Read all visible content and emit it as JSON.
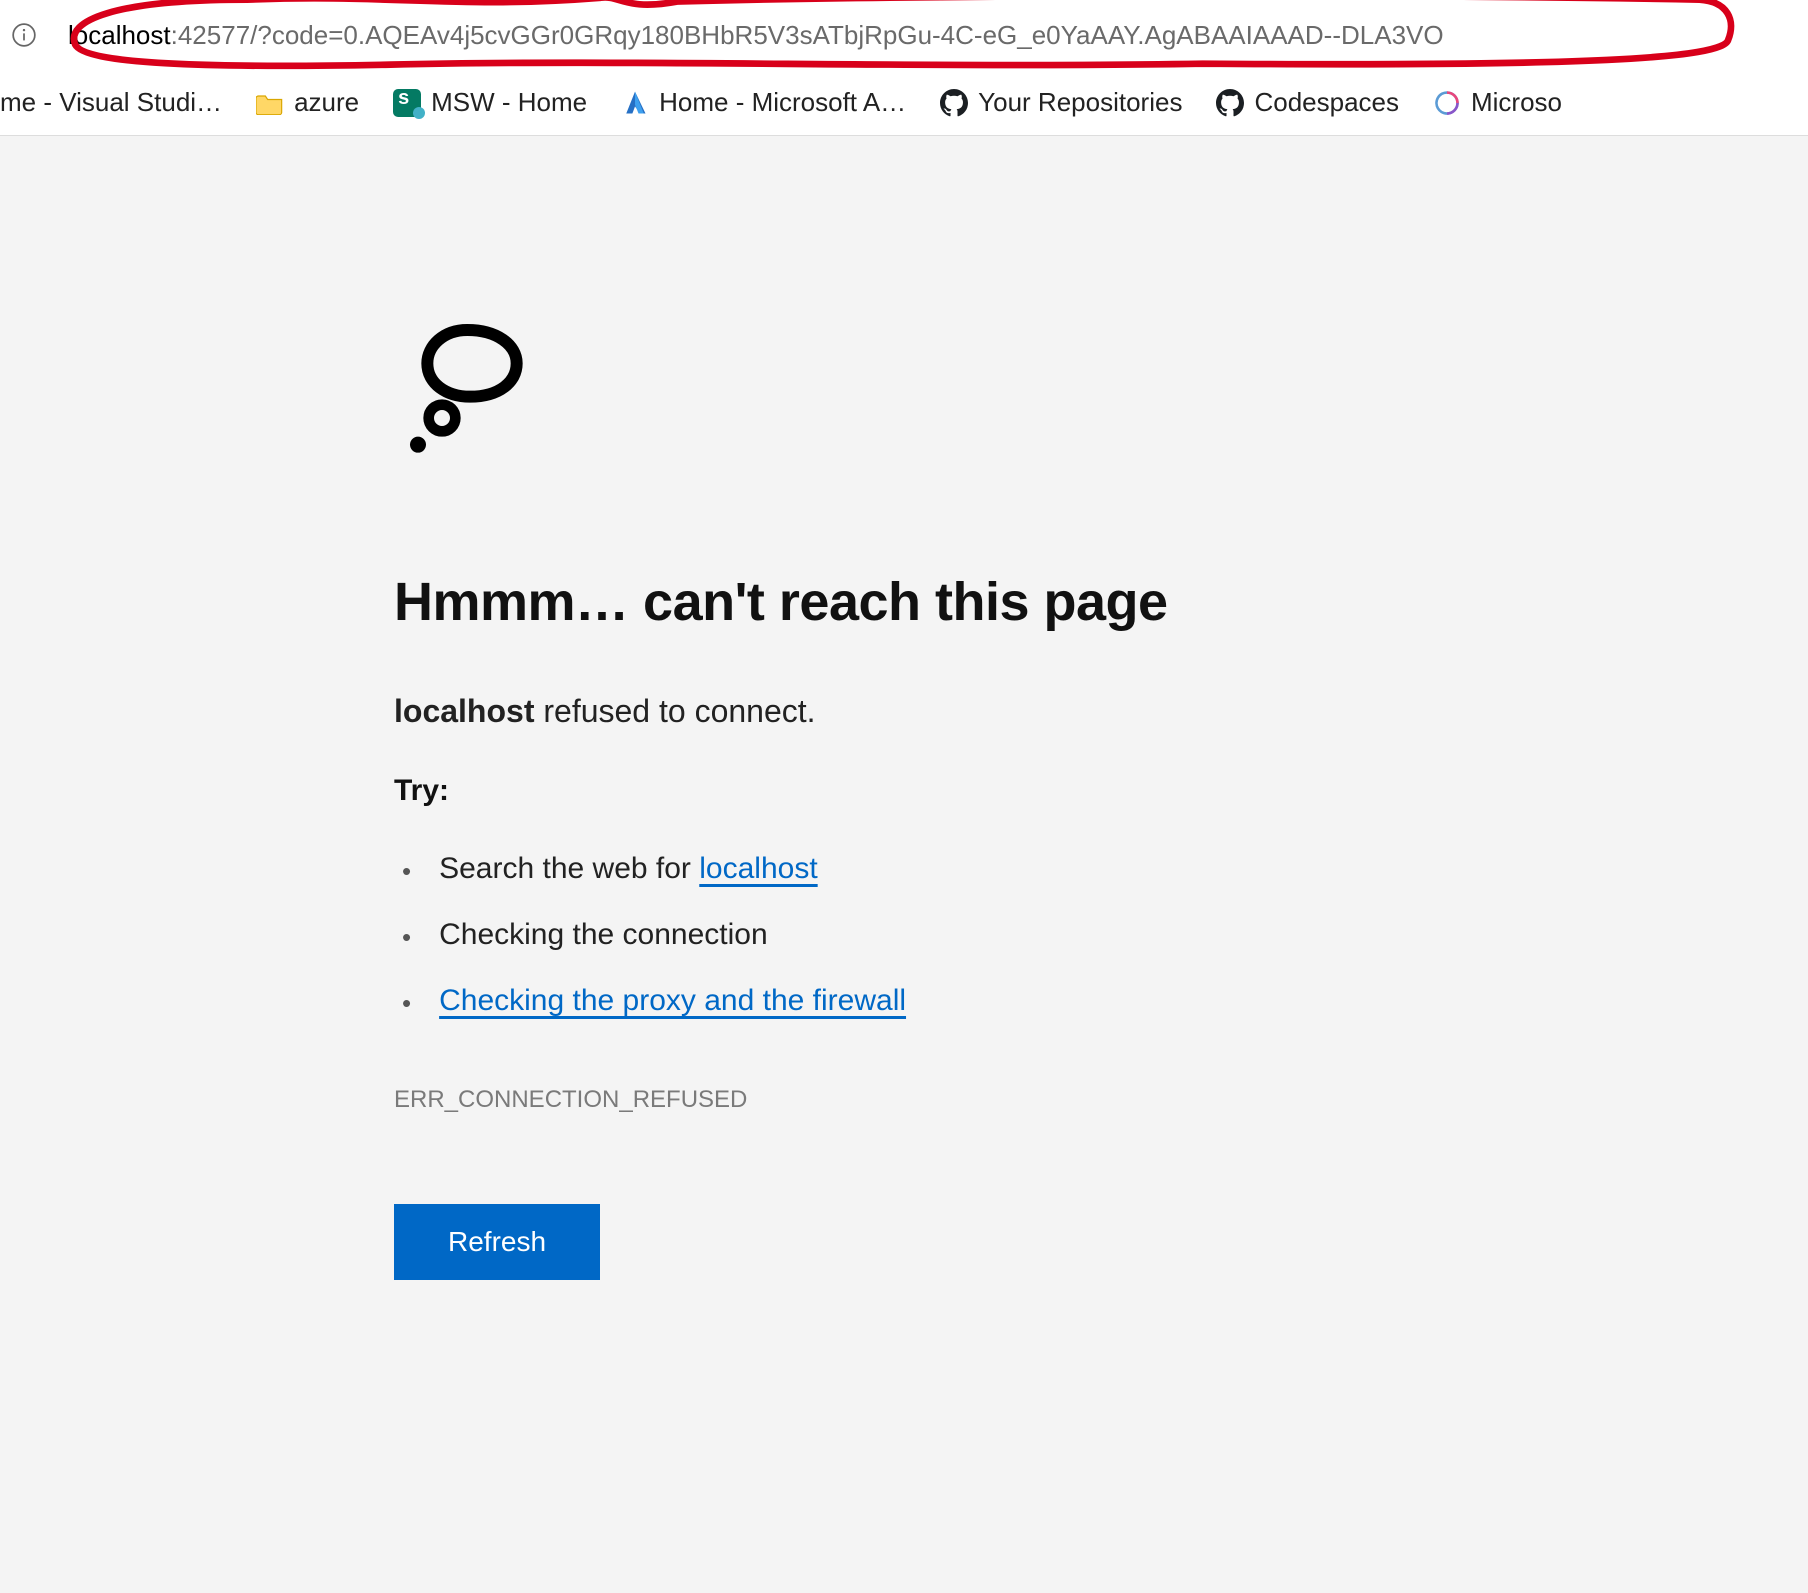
{
  "address_bar": {
    "host": "localhost",
    "rest": ":42577/?code=0.AQEAv4j5cvGGr0GRqy180BHbR5V3sATbjRpGu-4C-eG_e0YaAAY.AgABAAIAAAD--DLA3VO"
  },
  "bookmarks": [
    {
      "icon": "generic",
      "label": "me - Visual Studi…"
    },
    {
      "icon": "folder",
      "label": "azure"
    },
    {
      "icon": "sharepoint",
      "label": "MSW - Home"
    },
    {
      "icon": "azure",
      "label": "Home - Microsoft A…"
    },
    {
      "icon": "github",
      "label": "Your Repositories"
    },
    {
      "icon": "github",
      "label": "Codespaces"
    },
    {
      "icon": "copilot",
      "label": "Microso"
    }
  ],
  "error": {
    "headline": "Hmmm… can't reach this page",
    "host": "localhost",
    "refused_text": " refused to connect.",
    "try_label": "Try:",
    "tip_search_prefix": "Search the web for ",
    "tip_search_link": "localhost",
    "tip_connection": "Checking the connection",
    "tip_proxy_link": "Checking the proxy and the firewall",
    "error_code": "ERR_CONNECTION_REFUSED",
    "refresh_label": "Refresh"
  }
}
